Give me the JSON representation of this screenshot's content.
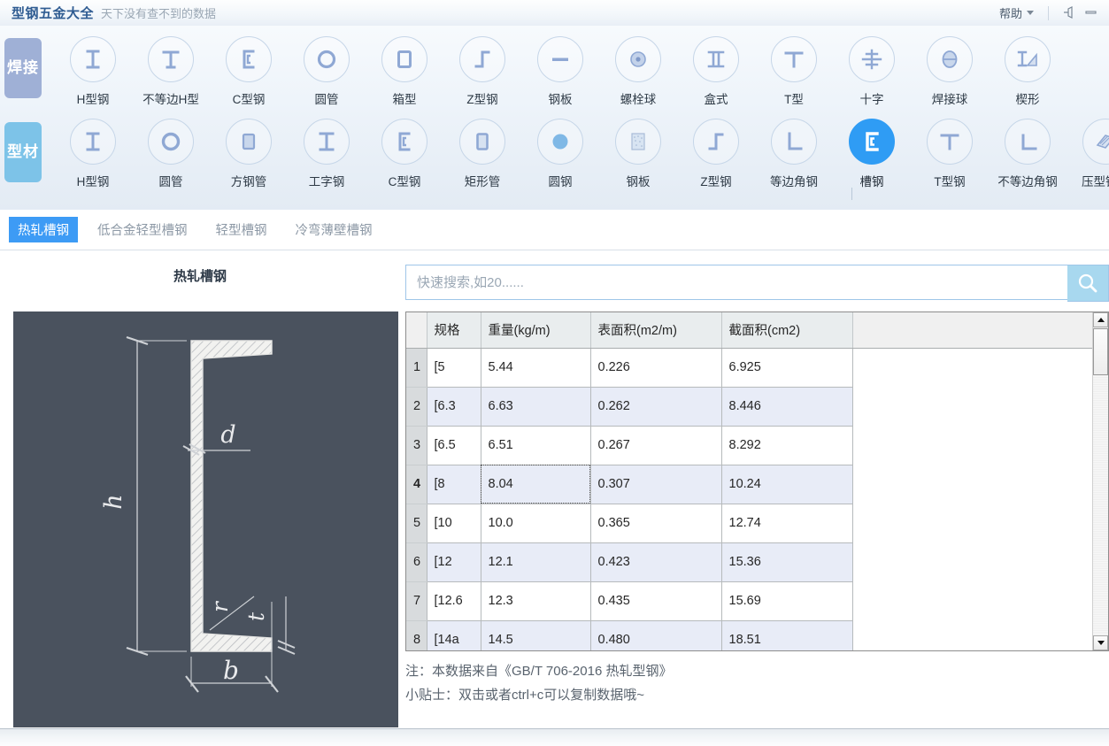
{
  "titlebar": {
    "app_title": "型钢五金大全",
    "slogan": "天下没有查不到的数据",
    "help_label": "帮助",
    "pin_icon": "pin-icon",
    "minimize_icon": "minimize-icon"
  },
  "ribbon": {
    "rows": [
      {
        "tag": "焊接",
        "tag_color": "#9fb0d6",
        "items": [
          {
            "label": "H型钢",
            "icon": "h-beam-icon"
          },
          {
            "label": "不等边H型",
            "icon": "unequal-h-beam-icon"
          },
          {
            "label": "C型钢",
            "icon": "c-channel-icon"
          },
          {
            "label": "圆管",
            "icon": "round-tube-icon"
          },
          {
            "label": "箱型",
            "icon": "box-section-icon"
          },
          {
            "label": "Z型钢",
            "icon": "z-section-icon"
          },
          {
            "label": "钢板",
            "icon": "steel-plate-icon"
          },
          {
            "label": "螺栓球",
            "icon": "bolt-ball-icon"
          },
          {
            "label": "盒式",
            "icon": "double-i-icon"
          },
          {
            "label": "T型",
            "icon": "t-section-icon"
          },
          {
            "label": "十字",
            "icon": "cross-section-icon"
          },
          {
            "label": "焊接球",
            "icon": "welded-ball-icon"
          },
          {
            "label": "楔形",
            "icon": "wedge-icon"
          }
        ]
      },
      {
        "tag": "型材",
        "tag_color": "#7dc3e8",
        "items": [
          {
            "label": "H型钢",
            "icon": "h-beam-icon"
          },
          {
            "label": "圆管",
            "icon": "round-tube-icon"
          },
          {
            "label": "方钢管",
            "icon": "square-tube-icon"
          },
          {
            "label": "工字钢",
            "icon": "i-beam-icon"
          },
          {
            "label": "C型钢",
            "icon": "c-channel-icon"
          },
          {
            "label": "矩形管",
            "icon": "rect-tube-icon"
          },
          {
            "label": "圆钢",
            "icon": "round-bar-icon"
          },
          {
            "label": "钢板",
            "icon": "steel-plate-icon"
          },
          {
            "label": "Z型钢",
            "icon": "z-section-icon"
          },
          {
            "label": "等边角钢",
            "icon": "equal-angle-icon"
          },
          {
            "label": "槽钢",
            "icon": "channel-steel-icon",
            "selected": true
          },
          {
            "label": "T型钢",
            "icon": "t-section-icon"
          },
          {
            "label": "不等边角钢",
            "icon": "unequal-angle-icon"
          },
          {
            "label": "压型钢板",
            "icon": "corrugated-plate-icon"
          }
        ]
      }
    ],
    "selected_accent": "#2f9cf4"
  },
  "subtabs": {
    "items": [
      {
        "label": "热轧槽钢",
        "active": true
      },
      {
        "label": "低合金轻型槽钢",
        "active": false
      },
      {
        "label": "轻型槽钢",
        "active": false
      },
      {
        "label": "冷弯薄壁槽钢",
        "active": false
      }
    ],
    "active_color": "#3d9bf5"
  },
  "left_pane": {
    "title": "热轧槽钢",
    "diagram": {
      "name": "channel-steel-cross-section",
      "background": "#4a525e",
      "labels": [
        "h",
        "b",
        "d",
        "t",
        "r"
      ]
    }
  },
  "search": {
    "placeholder": "快速搜索,如20......",
    "value": "",
    "button_icon": "search-icon",
    "button_color": "#a8d8ef"
  },
  "table": {
    "columns": [
      "",
      "规格",
      "重量(kg/m)",
      "表面积(m2/m)",
      "截面积(cm2)"
    ],
    "bold_column_index": 2,
    "rows": [
      {
        "n": "1",
        "cells": [
          "[5",
          "5.44",
          "0.226",
          "6.925"
        ]
      },
      {
        "n": "2",
        "cells": [
          "[6.3",
          "6.63",
          "0.262",
          "8.446"
        ]
      },
      {
        "n": "3",
        "cells": [
          "[6.5",
          "6.51",
          "0.267",
          "8.292"
        ]
      },
      {
        "n": "4",
        "cells": [
          "[8",
          "8.04",
          "0.307",
          "10.24"
        ],
        "current": true,
        "selected_cell": 1
      },
      {
        "n": "5",
        "cells": [
          "[10",
          "10.0",
          "0.365",
          "12.74"
        ]
      },
      {
        "n": "6",
        "cells": [
          "[12",
          "12.1",
          "0.423",
          "15.36"
        ]
      },
      {
        "n": "7",
        "cells": [
          "[12.6",
          "12.3",
          "0.435",
          "15.69"
        ]
      },
      {
        "n": "8",
        "cells": [
          "[14a",
          "14.5",
          "0.480",
          "18.51"
        ]
      }
    ],
    "selection_color": "#bed5f5",
    "scrollbar": {
      "up_icon": "scroll-up-arrow-icon",
      "down_icon": "scroll-down-arrow-icon"
    }
  },
  "notes": {
    "source": "注：本数据来自《GB/T 706-2016  热轧型钢》",
    "tip": "小贴士：双击或者ctrl+c可以复制数据哦~"
  }
}
